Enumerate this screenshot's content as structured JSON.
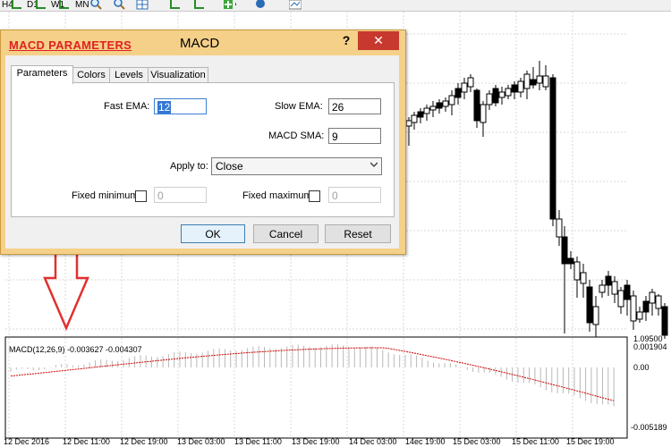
{
  "toolbar": {
    "timeframes": [
      "H4",
      "D1",
      "W1",
      "MN"
    ]
  },
  "dialog": {
    "title": "MACD",
    "overlay_caption": "MACD  PARAMETERS",
    "help_label": "?",
    "close_label": "✕",
    "tabs": [
      "Parameters",
      "Colors",
      "Levels",
      "Visualization"
    ],
    "active_tab": "Parameters",
    "fields": {
      "fast_ema": {
        "label": "Fast EMA:",
        "value": "12"
      },
      "slow_ema": {
        "label": "Slow EMA:",
        "value": "26"
      },
      "macd_sma": {
        "label": "MACD SMA:",
        "value": "9"
      },
      "apply_to": {
        "label": "Apply to:",
        "value": "Close"
      },
      "fixed_min": {
        "label": "Fixed minimum",
        "value": "0",
        "checked": false
      },
      "fixed_max": {
        "label": "Fixed maximum",
        "value": "0",
        "checked": false
      }
    },
    "buttons": {
      "ok": "OK",
      "cancel": "Cancel",
      "reset": "Reset"
    }
  },
  "chart": {
    "macd_legend": "MACD(12,26,9) -0.003627 -0.004307",
    "price_label_partial": "1.09500",
    "macd_y_labels": [
      "0.001904",
      "0.00",
      "-0.005189"
    ],
    "x_labels": [
      "12 Dec 2016",
      "12 Dec 11:00",
      "12 Dec 19:00",
      "13 Dec 03:00",
      "13 Dec 11:00",
      "13 Dec 19:00",
      "14 Dec 03:00",
      "14ec 19:00",
      "15 Dec 03:00",
      "15 Dec 11:00",
      "15 Dec 19:00"
    ],
    "colors": {
      "signal": "#cc0000",
      "histogram": "#b8b8b8",
      "grid": "#d8d8d8",
      "candle": "#000000",
      "arrow": "#e03030"
    }
  }
}
